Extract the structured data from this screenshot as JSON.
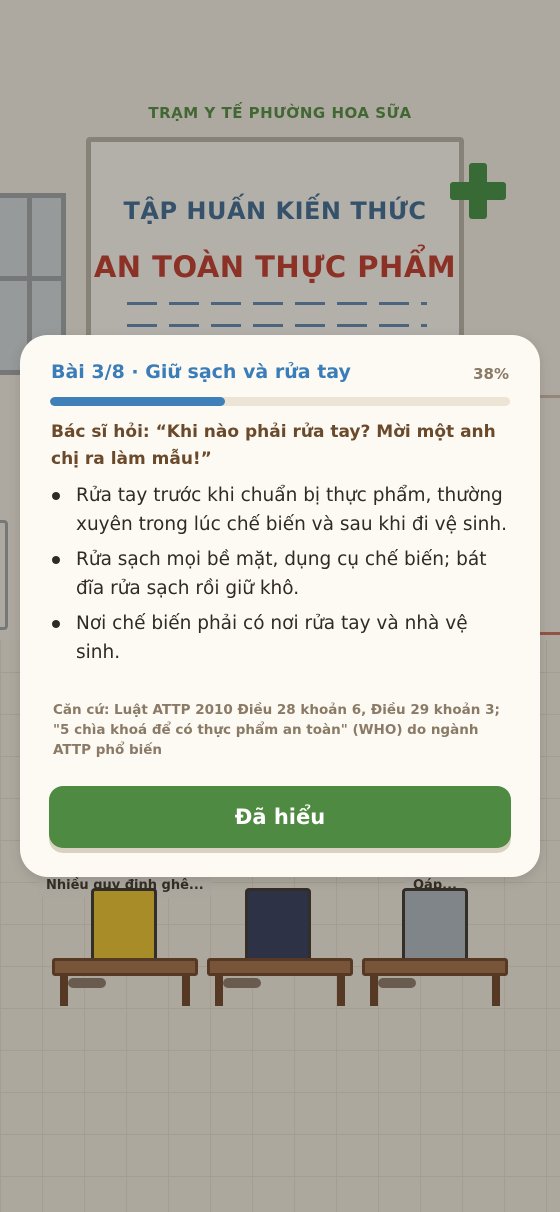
{
  "scene": {
    "clinic_name": "TRẠM Y TẾ PHƯỜNG HOA SỮA",
    "board_line1": "TẬP HUẤN KIẾN THỨC",
    "board_line2": "AN TOÀN THỰC PHẨM",
    "bubble_left": "Nhiều quy định ghê...",
    "bubble_right": "Oáp..."
  },
  "dialog": {
    "lesson_title": "Bài 3/8 · Giữ sạch và rửa tay",
    "progress_label": "38%",
    "progress_value": 0.38,
    "question": "Bác sĩ hỏi: “Khi nào phải rửa tay? Mời một anh chị ra làm mẫu!”",
    "bullets": [
      "Rửa tay trước khi chuẩn bị thực phẩm, thường xuyên trong lúc chế biến và sau khi đi vệ sinh.",
      "Rửa sạch mọi bề mặt, dụng cụ chế biến; bát đĩa rửa sạch rồi giữ khô.",
      "Nơi chế biến phải có nơi rửa tay và nhà vệ sinh."
    ],
    "source": "Căn cứ: Luật ATTP 2010 Điều 28 khoản 6, Điều 29 khoản 3; \"5 chìa khoá để có thực phẩm an toàn\" (WHO) do ngành ATTP phổ biến",
    "button_label": "Đã hiểu"
  },
  "colors": {
    "accent_blue": "#3a7db8",
    "button_green": "#4e8a41",
    "dialog_bg": "#fcfaf3"
  }
}
